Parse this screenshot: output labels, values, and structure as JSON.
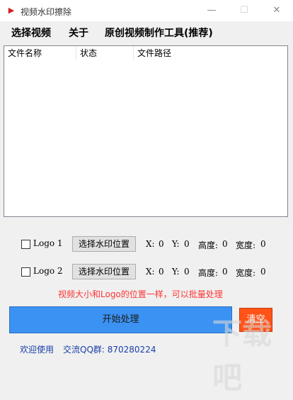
{
  "window": {
    "title": "视频水印擦除",
    "app_icon": "app-logo-icon",
    "minimize": "—",
    "maximize": "☐",
    "close": "✕"
  },
  "menu": {
    "items": [
      "选择视频",
      "关于",
      "原创视频制作工具(推荐)"
    ]
  },
  "list": {
    "columns": [
      "文件名称",
      "状态",
      "文件路径"
    ],
    "rows": []
  },
  "logos": [
    {
      "label": "Logo 1",
      "checked": false,
      "button": "选择水印位置",
      "x_label": "X:",
      "x": "0",
      "y_label": "Y:",
      "y": "0",
      "h_label": "高度:",
      "h": "0",
      "w_label": "宽度:",
      "w": "0"
    },
    {
      "label": "Logo 2",
      "checked": false,
      "button": "选择水印位置",
      "x_label": "X:",
      "x": "0",
      "y_label": "Y:",
      "y": "0",
      "h_label": "高度:",
      "h": "0",
      "w_label": "宽度:",
      "w": "0"
    }
  ],
  "notice": "视频大小和Logo的位置一样，可以批量处理",
  "actions": {
    "start": "开始处理",
    "clear": "清空"
  },
  "footer": {
    "welcome": "欢迎使用",
    "qq": "交流QQ群: 870280224"
  },
  "colors": {
    "start_button": "#3b92f2",
    "clear_button": "#ff5317",
    "notice": "#ff3333",
    "footer_text": "#1a3fa8"
  }
}
